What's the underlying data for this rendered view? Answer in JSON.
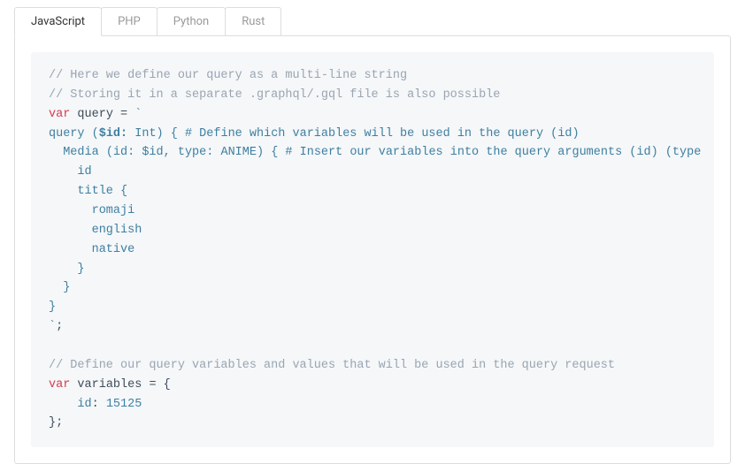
{
  "tabs": [
    {
      "label": "JavaScript",
      "active": true
    },
    {
      "label": "PHP",
      "active": false
    },
    {
      "label": "Python",
      "active": false
    },
    {
      "label": "Rust",
      "active": false
    }
  ],
  "code": {
    "c1": "// Here we define our query as a multi-line string",
    "c2": "// Storing it in a separate .graphql/.gql file is also possible",
    "kw_var": "var",
    "v_query": " query ",
    "eq": "=",
    "backtick": " `",
    "l4a": "query ",
    "l4b": "(",
    "l4c": "$id",
    "l4d": ":",
    "l4e": " Int",
    "l4f": ")",
    "l4g": " ",
    "l4h": "{",
    "l4i": " # Define which variables will be used in the query ",
    "l4j": "(",
    "l4k": "id",
    "l4l": ")",
    "l5a": "  Media ",
    "l5b": "(",
    "l5c": "id",
    "l5d": ":",
    "l5e": " $id",
    "l5f": ",",
    "l5g": " type",
    "l5h": ":",
    "l5i": " ANIME",
    "l5j": ")",
    "l5k": " ",
    "l5l": "{",
    "l5m": " # Insert our variables into the query arguments ",
    "l5n": "(",
    "l5o": "id",
    "l5p": ")",
    "l5q": " ",
    "l5r": "(",
    "l5s": "type",
    "l6": "    id",
    "l7a": "    title ",
    "l7b": "{",
    "l8": "      romaji",
    "l9": "      english",
    "l10": "      native",
    "l11": "    ",
    "l11b": "}",
    "l12": "  ",
    "l12b": "}",
    "l13": "}",
    "l14a": "`",
    "l14b": ";",
    "c3": "// Define our query variables and values that will be used in the query request",
    "v_variables": " variables ",
    "l17": " {",
    "l18a": "    id",
    "l18b": ":",
    "l18c": " ",
    "l18d": "15125",
    "l19a": "}",
    "l19b": ";"
  }
}
